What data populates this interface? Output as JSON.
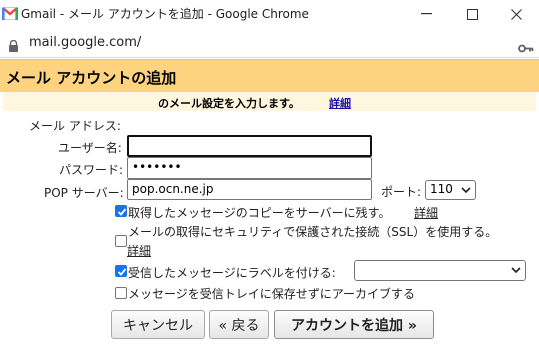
{
  "window": {
    "title": "Gmail - メール アカウントを追加 - Google Chrome",
    "url": "mail.google.com/",
    "icons": [
      "gmail-icon",
      "minimize-icon",
      "maximize-icon",
      "close-icon",
      "lock-icon",
      "key-icon"
    ]
  },
  "dialog": {
    "title": "メール アカウントの追加",
    "subtitle": "のメール設定を入力します。",
    "subtitle_link": "詳細",
    "email_label": "メール アドレス:",
    "username_label": "ユーザー名:",
    "username_value": "",
    "password_label": "パスワード:",
    "password_value": "•••••••",
    "pop_label": "POP サーバー:",
    "pop_value": "pop.ocn.ne.jp",
    "port_label": "ポート:",
    "port_value": "110",
    "options": [
      {
        "label": "取得したメッセージのコピーをサーバーに残す。",
        "link": "詳細",
        "checked": true
      },
      {
        "label": "メールの取得にセキュリティで保護された接続（SSL）を使用する。",
        "link": "詳細",
        "checked": false
      },
      {
        "label": "受信したメッセージにラベルを付ける:",
        "checked": true
      },
      {
        "label": "メッセージを受信トレイに保存せずにアーカイブする",
        "checked": false
      }
    ],
    "label_select_value": "",
    "buttons": {
      "cancel": "キャンセル",
      "back": "« 戻る",
      "add": "アカウントを追加 »"
    }
  },
  "colors": {
    "header_bg": "#fdd37f",
    "subheader_bg": "#fff6df",
    "link": "#1a0dab",
    "checkbox_checked": "#1a73e8"
  }
}
